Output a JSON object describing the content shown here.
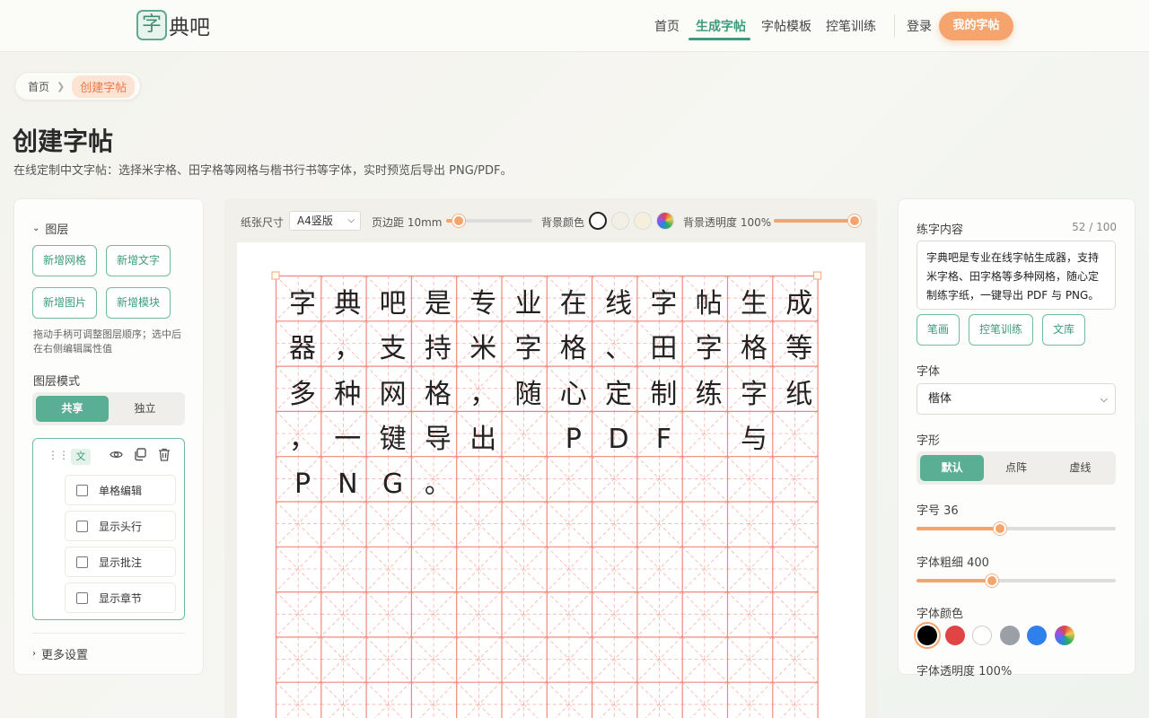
{
  "header": {
    "logo_char": "字",
    "logo_text": "典吧",
    "nav": [
      "首页",
      "生成字帖",
      "字帖模板",
      "控笔训练"
    ],
    "active_nav": "生成字帖",
    "login": "登录",
    "my_button": "我的字帖"
  },
  "breadcrumb": {
    "home": "首页",
    "current": "创建字帖"
  },
  "page": {
    "title": "创建字帖",
    "subtitle": "在线定制中文字帖：选择米字格、田字格等网格与楷书行书等字体，实时预览后导出 PNG/PDF。"
  },
  "left": {
    "layers_label": "图层",
    "add_buttons": [
      "新增网格",
      "新增文字",
      "新增图片",
      "新增模块"
    ],
    "hint": "拖动手柄可调整图层顺序；选中后在右侧编辑属性值",
    "mode_label": "图层模式",
    "modes": [
      "共享",
      "独立"
    ],
    "active_mode": "共享",
    "layer_tag": "文",
    "options": [
      "单格编辑",
      "显示头行",
      "显示批注",
      "显示章节"
    ],
    "more_settings": "更多设置"
  },
  "toolbar": {
    "paper_label": "纸张尺寸",
    "paper_value": "A4竖版",
    "margin_label": "页边距 10mm",
    "margin_level": 0.15,
    "bg_color_label": "背景颜色",
    "bg_colors": [
      "#ffffff",
      "#f2f0e6",
      "#f5efdc",
      "multicolor"
    ],
    "opacity_label": "背景透明度 100%",
    "opacity_level": 1.0
  },
  "preview": {
    "rows": [
      [
        "字",
        "典",
        "吧",
        "是",
        "专",
        "业",
        "在",
        "线",
        "字",
        "帖",
        "生",
        "成"
      ],
      [
        "器",
        "，",
        "支",
        "持",
        "米",
        "字",
        "格",
        "、",
        "田",
        "字",
        "格",
        "等"
      ],
      [
        "多",
        "种",
        "网",
        "格",
        "，",
        "随",
        "心",
        "定",
        "制",
        "练",
        "字",
        "纸"
      ],
      [
        "，",
        "一",
        "键",
        "导",
        "出",
        "",
        "P",
        "D",
        "F",
        "",
        "与",
        ""
      ],
      [
        "P",
        "N",
        "G",
        "。",
        "",
        "",
        "",
        "",
        "",
        "",
        "",
        ""
      ]
    ],
    "grid_color": "#f08a7a"
  },
  "right": {
    "content_label": "练字内容",
    "count": "52 / 100",
    "content": "字典吧是专业在线字帖生成器，支持米字格、田字格等多种网格，随心定制练字纸，一键导出 PDF 与 PNG。",
    "tool_buttons": [
      "笔画",
      "控笔训练",
      "文库"
    ],
    "font_label": "字体",
    "font_value": "楷体",
    "shape_label": "字形",
    "shapes": [
      "默认",
      "点阵",
      "虚线"
    ],
    "active_shape": "默认",
    "size_label": "字号 36",
    "size_level": 0.42,
    "weight_label": "字体粗细 400",
    "weight_level": 0.38,
    "color_label": "字体颜色",
    "colors": [
      "#000000",
      "#e04444",
      "#ffffff",
      "#9aa0a6",
      "#2f80ed",
      "multicolor"
    ],
    "font_opacity_label": "字体透明度 100%"
  }
}
